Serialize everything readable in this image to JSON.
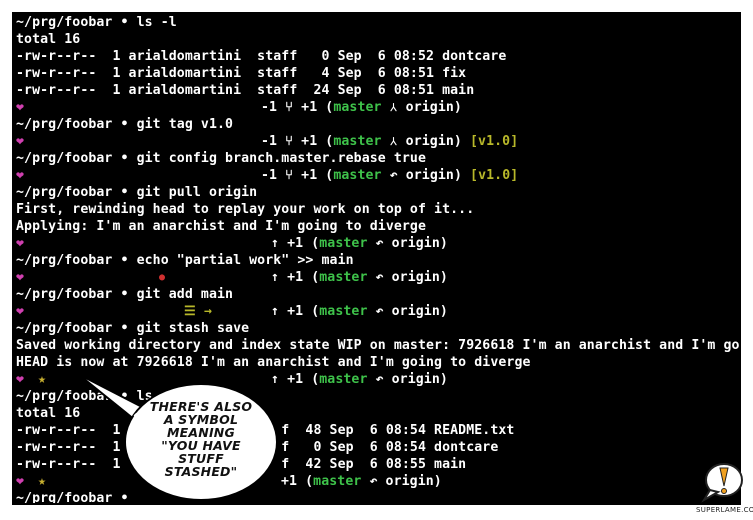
{
  "terminal": {
    "lines": [
      "~/prg/foobar • ls -l",
      "total 16",
      "-rw-r--r--  1 arialdomartini  staff   0 Sep  6 08:52 dontcare",
      "-rw-r--r--  1 arialdomartini  staff   4 Sep  6 08:51 fix",
      "-rw-r--r--  1 arialdomartini  staff  24 Sep  6 08:51 main",
      "",
      "~/prg/foobar • git tag v1.0",
      "",
      "~/prg/foobar • git config branch.master.rebase true",
      "",
      "~/prg/foobar • git pull origin",
      "First, rewinding head to replay your work on top of it...",
      "Applying: I'm an anarchist and I'm going to diverge",
      "",
      "~/prg/foobar • echo \"partial work\" >> main",
      "",
      "~/prg/foobar • git add main",
      "",
      "~/prg/foobar • git stash save",
      "Saved working directory and index state WIP on master: 7926618 I'm an anarchist and I'm goi",
      "HEAD is now at 7926618 I'm an anarchist and I'm going to diverge",
      "",
      "~/prg/foobar • ls",
      "total 16",
      "-rw-r--r--  1                    f  48 Sep  6 08:54 README.txt",
      "-rw-r--r--  1                    f   0 Sep  6 08:54 dontcare",
      "-rw-r--r--  1                    f  42 Sep  6 08:55 main",
      "",
      "~/prg/foobar •"
    ],
    "status_lines": {
      "s1": {
        "pre": "-1 ⑂ +1 (",
        "branch": "master",
        "mid": " ⅄ origin)",
        "tag": ""
      },
      "s2": {
        "pre": "-1 ⑂ +1 (",
        "branch": "master",
        "mid": " ⅄ origin)",
        "tag": " [v1.0]"
      },
      "s3": {
        "pre": "-1 ⑂ +1 (",
        "branch": "master",
        "mid": " ↶ origin)",
        "tag": " [v1.0]"
      },
      "s4": {
        "pre": "↑ +1 (",
        "branch": "master",
        "mid": " ↶ origin)",
        "tag": ""
      },
      "s5": {
        "pre": "↑ +1 (",
        "branch": "master",
        "mid": " ↶ origin)",
        "tag": ""
      },
      "s6": {
        "pre": "↑ +1 (",
        "branch": "master",
        "mid": " ↶ origin)",
        "tag": ""
      },
      "s7": {
        "pre": "↑ +1 (",
        "branch": "master",
        "mid": " ↶ origin)",
        "tag": ""
      },
      "s8": {
        "pre": "",
        "branch": "master",
        "mid": " ↶ origin)",
        "tag": ""
      }
    },
    "symbols": {
      "heart": "❤",
      "star": "★",
      "staged": "☰ →",
      "dot": "●",
      "s8_prefix": "+1 ("
    }
  },
  "bubble": {
    "lines": [
      "There's also",
      "a symbol",
      "meaning",
      "\"you have",
      "stuff",
      "stashed\""
    ]
  },
  "logo": {
    "text": "SUPERLAME.COM"
  },
  "colors": {
    "prompt_text": "#ffffff",
    "branch": "#3ec24a",
    "tag": "#b8b82a",
    "heart": "#d040b0",
    "star": "#c8b030"
  }
}
